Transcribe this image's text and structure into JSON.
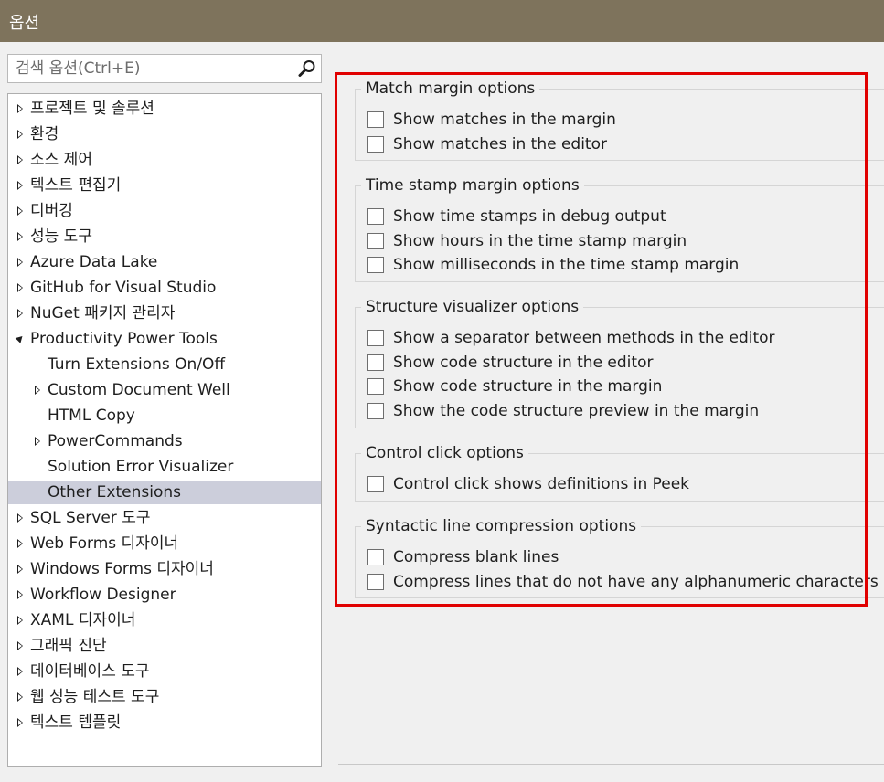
{
  "window": {
    "title": "옵션"
  },
  "search": {
    "placeholder": "검색 옵션(Ctrl+E)"
  },
  "tree": {
    "items": [
      {
        "label": "프로젝트 및 솔루션",
        "arrow": "collapsed",
        "indent": 0
      },
      {
        "label": "환경",
        "arrow": "collapsed",
        "indent": 0
      },
      {
        "label": "소스 제어",
        "arrow": "collapsed",
        "indent": 0
      },
      {
        "label": "텍스트 편집기",
        "arrow": "collapsed",
        "indent": 0
      },
      {
        "label": "디버깅",
        "arrow": "collapsed",
        "indent": 0
      },
      {
        "label": "성능 도구",
        "arrow": "collapsed",
        "indent": 0
      },
      {
        "label": "Azure Data Lake",
        "arrow": "collapsed",
        "indent": 0
      },
      {
        "label": "GitHub for Visual Studio",
        "arrow": "collapsed",
        "indent": 0
      },
      {
        "label": "NuGet 패키지 관리자",
        "arrow": "collapsed",
        "indent": 0
      },
      {
        "label": "Productivity Power Tools",
        "arrow": "expanded",
        "indent": 0
      },
      {
        "label": "Turn Extensions On/Off",
        "arrow": "none",
        "indent": 1
      },
      {
        "label": "Custom Document Well",
        "arrow": "collapsed",
        "indent": 1
      },
      {
        "label": "HTML Copy",
        "arrow": "none",
        "indent": 1
      },
      {
        "label": "PowerCommands",
        "arrow": "collapsed",
        "indent": 1
      },
      {
        "label": "Solution Error Visualizer",
        "arrow": "none",
        "indent": 1
      },
      {
        "label": "Other Extensions",
        "arrow": "none",
        "indent": 1,
        "selected": true
      },
      {
        "label": "SQL Server 도구",
        "arrow": "collapsed",
        "indent": 0
      },
      {
        "label": "Web Forms 디자이너",
        "arrow": "collapsed",
        "indent": 0
      },
      {
        "label": "Windows Forms 디자이너",
        "arrow": "collapsed",
        "indent": 0
      },
      {
        "label": "Workflow Designer",
        "arrow": "collapsed",
        "indent": 0
      },
      {
        "label": "XAML 디자이너",
        "arrow": "collapsed",
        "indent": 0
      },
      {
        "label": "그래픽 진단",
        "arrow": "collapsed",
        "indent": 0
      },
      {
        "label": "데이터베이스 도구",
        "arrow": "collapsed",
        "indent": 0
      },
      {
        "label": "웹 성능 테스트 도구",
        "arrow": "collapsed",
        "indent": 0
      },
      {
        "label": "텍스트 템플릿",
        "arrow": "collapsed",
        "indent": 0
      }
    ]
  },
  "groups": [
    {
      "title": "Match margin options",
      "options": [
        {
          "label": "Show matches in the margin",
          "checked": false
        },
        {
          "label": "Show matches in the editor",
          "checked": false
        }
      ]
    },
    {
      "title": "Time stamp margin options",
      "options": [
        {
          "label": "Show time stamps in debug output",
          "checked": false
        },
        {
          "label": "Show hours in the time stamp margin",
          "checked": false
        },
        {
          "label": "Show milliseconds in the time stamp margin",
          "checked": false
        }
      ]
    },
    {
      "title": "Structure visualizer options",
      "options": [
        {
          "label": "Show a separator between methods in the editor",
          "checked": false
        },
        {
          "label": "Show code structure in the editor",
          "checked": false
        },
        {
          "label": "Show code structure in the margin",
          "checked": false
        },
        {
          "label": "Show the code structure preview in the margin",
          "checked": false
        }
      ]
    },
    {
      "title": "Control click options",
      "options": [
        {
          "label": "Control click shows definitions in Peek",
          "checked": false
        }
      ]
    },
    {
      "title": "Syntactic line compression options",
      "options": [
        {
          "label": "Compress blank lines",
          "checked": false
        },
        {
          "label": "Compress lines that do not have any alphanumeric characters",
          "checked": false
        }
      ]
    }
  ],
  "colors": {
    "titlebar": "#7e735c",
    "selection": "#cccedb",
    "highlight": "#e00000"
  }
}
